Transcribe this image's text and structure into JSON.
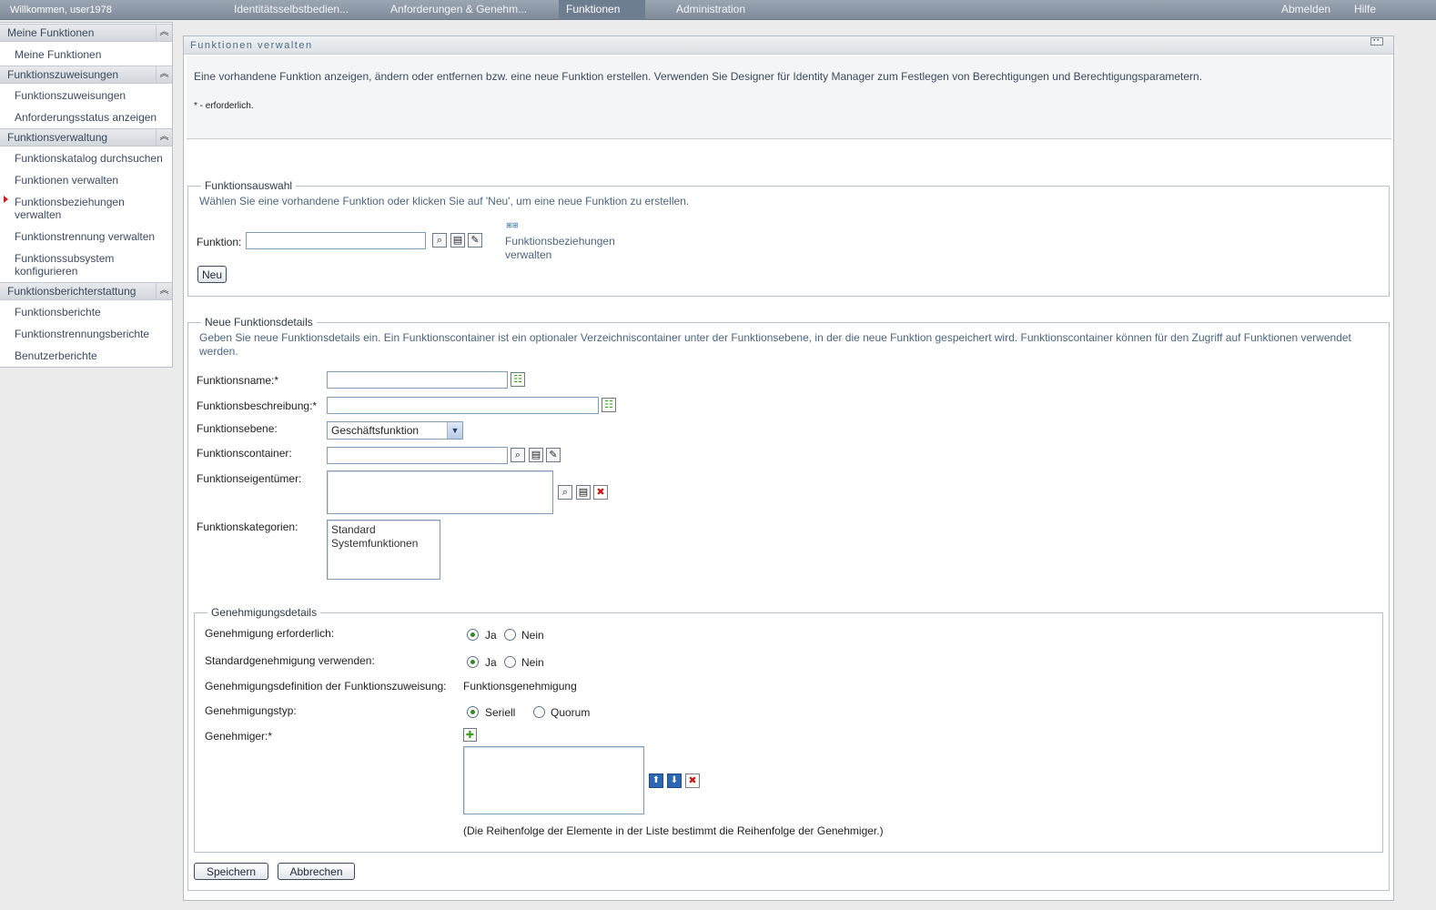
{
  "topbar": {
    "welcome": "Willkommen, user1978",
    "tabs": [
      {
        "label": "Identitätsselbstbedien...",
        "active": false
      },
      {
        "label": "Anforderungen & Genehm...",
        "active": false
      },
      {
        "label": "Funktionen",
        "active": true
      },
      {
        "label": "Administration",
        "active": false
      }
    ],
    "logout": "Abmelden",
    "help": "Hilfe"
  },
  "sidebar": {
    "sections": [
      {
        "title": "Meine Funktionen",
        "items": [
          "Meine Funktionen"
        ]
      },
      {
        "title": "Funktionszuweisungen",
        "items": [
          "Funktionszuweisungen",
          "Anforderungsstatus anzeigen"
        ]
      },
      {
        "title": "Funktionsverwaltung",
        "items": [
          "Funktionskatalog durchsuchen",
          "Funktionen verwalten",
          "Funktionsbeziehungen verwalten",
          "Funktionstrennung verwalten",
          "Funktionssubsystem konfigurieren"
        ]
      },
      {
        "title": "Funktionsberichterstattung",
        "items": [
          "Funktionsberichte",
          "Funktionstrennungsberichte",
          "Benutzerberichte"
        ]
      }
    ],
    "active_item": "Funktionen verwalten"
  },
  "panel": {
    "title": "Funktionen verwalten",
    "intro": "Eine vorhandene Funktion anzeigen, ändern oder entfernen bzw. eine neue Funktion erstellen. Verwenden Sie Designer für Identity Manager zum Festlegen von Berechtigungen und Berechtigungsparametern.",
    "required_note": "* - erforderlich."
  },
  "selection": {
    "legend": "Funktionsauswahl",
    "help": "Wählen Sie eine vorhandene Funktion oder klicken Sie auf 'Neu', um eine neue Funktion zu erstellen.",
    "function_label": "Funktion:",
    "function_value": "",
    "relations_link": "Funktionsbeziehungen verwalten",
    "new_button": "Neu"
  },
  "details": {
    "legend": "Neue Funktionsdetails",
    "help": "Geben Sie neue Funktionsdetails ein. Ein Funktionscontainer ist ein optionaler Verzeichniscontainer unter der Funktionsebene, in der die neue Funktion gespeichert wird. Funktionscontainer können für den Zugriff auf Funktionen verwendet werden.",
    "name_label": "Funktionsname:*",
    "name_value": "",
    "description_label": "Funktionsbeschreibung:*",
    "description_value": "",
    "level_label": "Funktionsebene:",
    "level_value": "Geschäftsfunktion",
    "container_label": "Funktionscontainer:",
    "container_value": "",
    "owners_label": "Funktionseigentümer:",
    "categories_label": "Funktionskategorien:",
    "categories": [
      "Standard",
      "Systemfunktionen"
    ]
  },
  "approval": {
    "legend": "Genehmigungsdetails",
    "required_label": "Genehmigung erforderlich:",
    "required_yes": "Ja",
    "required_no": "Nein",
    "required_selected": "Ja",
    "standard_label": "Standardgenehmigung verwenden:",
    "standard_yes": "Ja",
    "standard_no": "Nein",
    "standard_selected": "Ja",
    "definition_label": "Genehmigungsdefinition der Funktionszuweisung:",
    "definition_value": "Funktionsgenehmigung",
    "type_label": "Genehmigungstyp:",
    "type_serial": "Seriell",
    "type_quorum": "Quorum",
    "type_selected": "Seriell",
    "approvers_label": "Genehmiger:*",
    "order_note": "(Die Reihenfolge der Elemente in der Liste bestimmt die Reihenfolge der Genehmiger.)"
  },
  "actions": {
    "save": "Speichern",
    "cancel": "Abbrechen"
  },
  "icons": {
    "search": "search-icon",
    "browse": "object-browser-icon",
    "edit": "edit-icon",
    "localize": "localize-icon",
    "delete": "delete-icon",
    "move_up": "arrow-up-icon",
    "move_down": "arrow-down-icon",
    "add": "plus-icon",
    "collapse": "collapse-icon",
    "relations": "relations-icon"
  },
  "colors": {
    "topbar": "#8a96a4",
    "active_tab": "#6e7d90",
    "link_text": "#4d6580",
    "active_marker": "#cc1b1b",
    "radio_dot": "#2f8a21"
  }
}
